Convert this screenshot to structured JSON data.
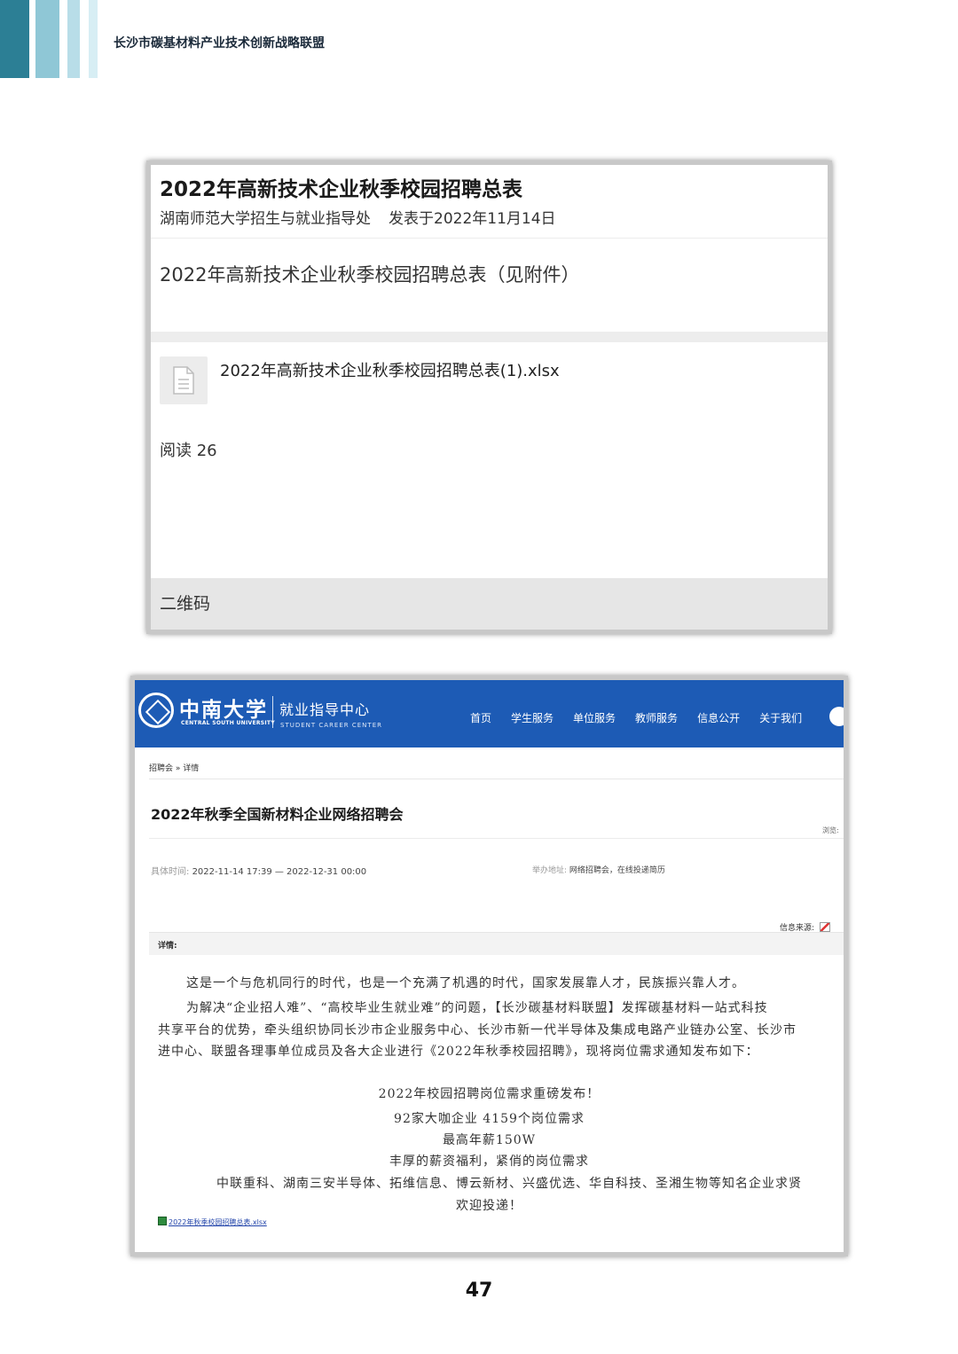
{
  "header": {
    "title": "长沙市碳基材料产业技术创新战略联盟"
  },
  "shot1": {
    "title": "2022年高新技术企业秋季校园招聘总表",
    "publisher": "湖南师范大学招生与就业指导处",
    "published": "发表于2022年11月14日",
    "body": "2022年高新技术企业秋季校园招聘总表（见附件）",
    "attachment_name": "2022年高新技术企业秋季校园招聘总表(1).xlsx",
    "reads": "阅读 26",
    "qr_label": "二维码"
  },
  "shot2": {
    "school_cn": "中南大学",
    "school_en": "CENTRAL SOUTH UNIVERSITY",
    "center_cn": "就业指导中心",
    "center_en": "STUDENT CAREER CENTER",
    "nav": [
      "首页",
      "学生服务",
      "单位服务",
      "教师服务",
      "信息公开",
      "关于我们"
    ],
    "breadcrumb": "招聘会 » 详情",
    "title": "2022年秋季全国新材料企业网络招聘会",
    "views_label": "浏览:",
    "time_label": "具体时间:",
    "time_value": "2022-11-14 17:39 — 2022-12-31 00:00",
    "addr_label": "举办地址:",
    "addr_value": "网络招聘会，在线投递简历",
    "source_label": "信息来源:",
    "detail_label": "详情:",
    "para1": "这是一个与危机同行的时代，也是一个充满了机遇的时代，国家发展靠人才，民族振兴靠人才。",
    "para2a": "为解决“企业招人难”、“高校毕业生就业难”的问题，【长沙碳基材料联盟】发挥碳基材料一站式科技",
    "para2b": "共享平台的优势，牵头组织协同长沙市企业服务中心、长沙市新一代半导体及集成电路产业链办公室、长沙市",
    "para2c": "进中心、联盟各理事单位成员及各大企业进行《2022年秋季校园招聘》，现将岗位需求通知发布如下：",
    "c1": "2022年校园招聘岗位需求重磅发布！",
    "c2": "92家大咖企业 4159个岗位需求",
    "c3": "最高年薪150W",
    "c4": "丰厚的薪资福利，紧俏的岗位需求",
    "c5": "中联重科、湖南三安半导体、拓维信息、博云新材、兴盛优选、华自科技、圣湘生物等知名企业求贤",
    "c6": "欢迎投递！",
    "attachment": "2022年秋季校园招聘总表.xlsx"
  },
  "page_number": "47"
}
